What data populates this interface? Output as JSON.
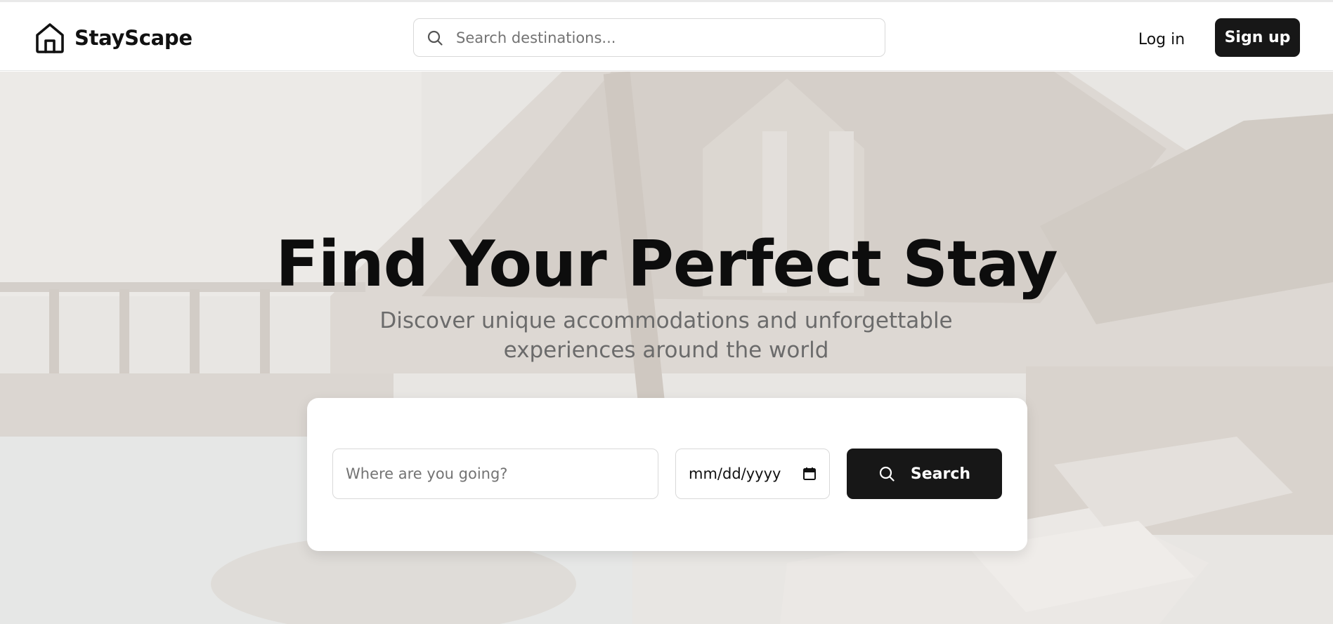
{
  "header": {
    "brand_name": "StayScape",
    "search_placeholder": "Search destinations...",
    "login_label": "Log in",
    "signup_label": "Sign up"
  },
  "hero": {
    "title": "Find Your Perfect Stay",
    "subtitle": "Discover unique accommodations and unforgettable experiences around the world"
  },
  "search_form": {
    "destination_placeholder": "Where are you going?",
    "date_placeholder": "mm/dd/yyyy",
    "search_label": "Search"
  },
  "icons": {
    "logo": "house-icon",
    "top_search": "search-icon",
    "date": "calendar-icon",
    "search_button": "search-icon"
  },
  "colors": {
    "primary_button": "#171717",
    "placeholder_text": "#737373",
    "subtitle_text": "#6b6b6b",
    "hero_overlay": "#e7e4e1"
  }
}
